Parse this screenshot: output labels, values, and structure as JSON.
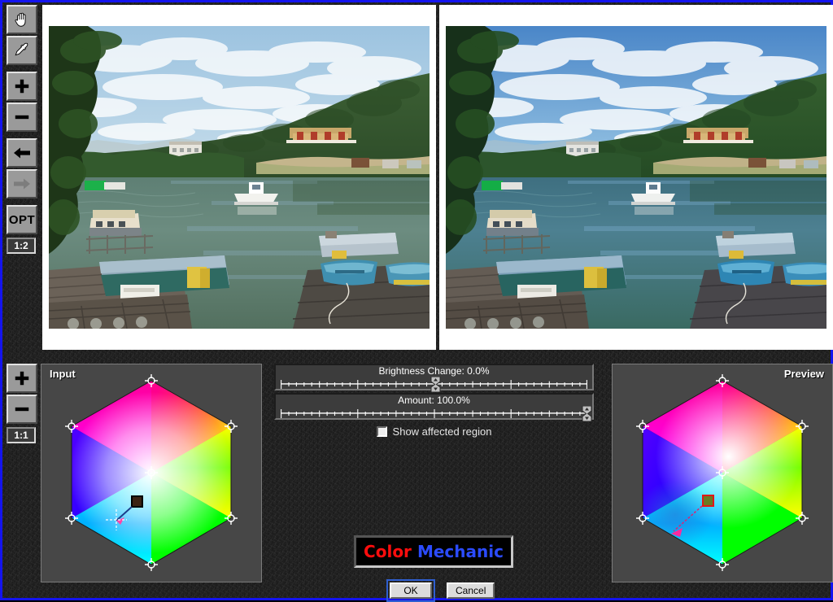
{
  "app": {
    "name": "Color Mechanic",
    "logo_part1": "Color",
    "logo_part2": "Mechanic",
    "accent_border": "#1414ee",
    "logo_color_1": "#ff0d0d",
    "logo_color_2": "#2b4bff"
  },
  "toolbar_top": {
    "items": [
      {
        "name": "hand-tool",
        "icon": "hand-icon",
        "label": "",
        "state": "selected"
      },
      {
        "name": "eyedropper-tool",
        "icon": "eyedropper-icon",
        "label": "",
        "state": "normal"
      },
      {
        "name": "zoom-in-tool",
        "icon": "plus-icon",
        "label": "",
        "state": "normal"
      },
      {
        "name": "zoom-out-tool",
        "icon": "minus-icon",
        "label": "",
        "state": "normal"
      },
      {
        "name": "back-tool",
        "icon": "arrow-left-icon",
        "label": "",
        "state": "normal"
      },
      {
        "name": "forward-tool",
        "icon": "arrow-right-icon",
        "label": "",
        "state": "disabled"
      },
      {
        "name": "options-tool",
        "icon": "text-icon",
        "label": "OPT",
        "state": "normal"
      }
    ],
    "zoom_label": "1:2"
  },
  "toolbar_bottom": {
    "items": [
      {
        "name": "hex-zoom-in-tool",
        "icon": "plus-icon",
        "label": "",
        "state": "normal"
      },
      {
        "name": "hex-zoom-out-tool",
        "icon": "minus-icon",
        "label": "",
        "state": "normal"
      }
    ],
    "zoom_label": "1:1"
  },
  "panels": {
    "original_title": "",
    "preview_title": "",
    "input_label": "Input",
    "preview_label": "Preview"
  },
  "sliders": [
    {
      "name": "brightness-change-slider",
      "label": "Brightness Change: 0.0%",
      "value": 0.0,
      "unit": "%",
      "thumb_percent": 50,
      "min": -100,
      "max": 100
    },
    {
      "name": "amount-slider",
      "label": "Amount: 100.0%",
      "value": 100.0,
      "unit": "%",
      "thumb_percent": 100,
      "min": 0,
      "max": 100
    }
  ],
  "checkbox": {
    "label": "Show affected region",
    "checked": false
  },
  "buttons": {
    "ok": "OK",
    "cancel": "Cancel",
    "focused": "ok"
  },
  "color_markers": {
    "input": {
      "source_color": "#3a2112",
      "target_color": "#ff44a8",
      "arrow_color": "#1c3f8a"
    },
    "preview": {
      "source_color": "#b03020",
      "target_color": "#ff2a9d",
      "arrow_color": "#d12a7a"
    }
  }
}
